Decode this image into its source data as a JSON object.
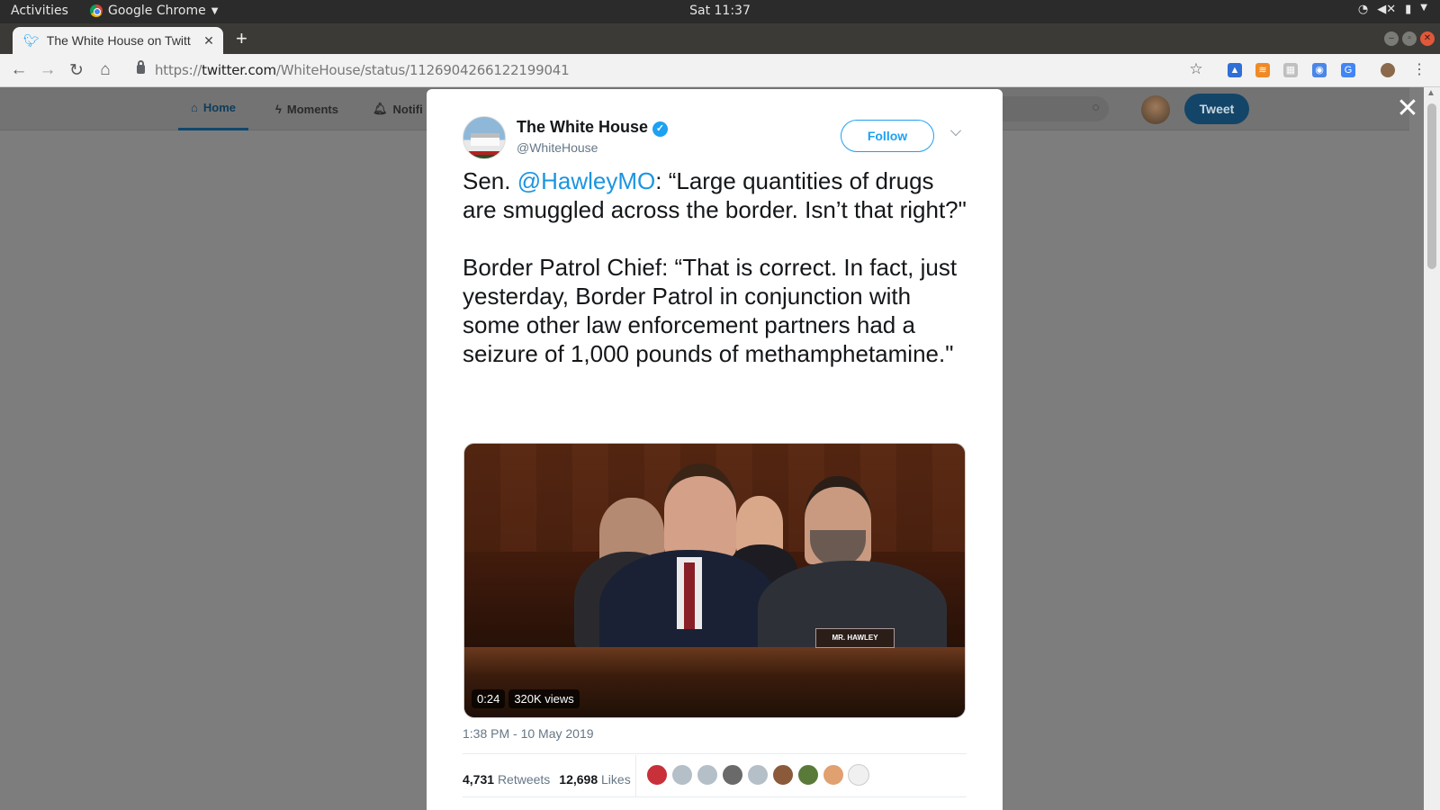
{
  "system_bar": {
    "activities": "Activities",
    "app_name": "Google Chrome",
    "clock": "Sat 11:37"
  },
  "browser": {
    "tab_title": "The White House on Twitt",
    "url_prefix": "https://",
    "url_host": "twitter.com",
    "url_path": "/WhiteHouse/status/1126904266122199041"
  },
  "twitter_nav": {
    "home": "Home",
    "moments": "Moments",
    "notifications": "Notifi",
    "search_placeholder": "r",
    "tweet_button": "Tweet"
  },
  "tweet": {
    "author_name": "The White House",
    "author_handle": "@WhiteHouse",
    "follow_label": "Follow",
    "text_prefix": "Sen. ",
    "mention": "@HawleyMO",
    "text_rest": ": “Large quantities of drugs are smuggled across the border. Isn’t that right?\"",
    "text_paragraph_2": "Border Patrol Chief: “That is correct. In fact, just yesterday, Border Patrol in conjunction with some other law enforcement partners had a seizure of 1,000 pounds of methamphetamine.\"",
    "video_duration": "0:24",
    "video_views": "320K views",
    "nameplate": "MR. HAWLEY",
    "timestamp": "1:38 PM - 10 May 2019",
    "retweets_count": "4,731",
    "retweets_label": "Retweets",
    "likes_count": "12,698",
    "likes_label": "Likes"
  },
  "colors": {
    "twitter_blue": "#1da1f2",
    "mention_blue": "#1b95e0",
    "overlay_gray": "#7d7d7d"
  }
}
